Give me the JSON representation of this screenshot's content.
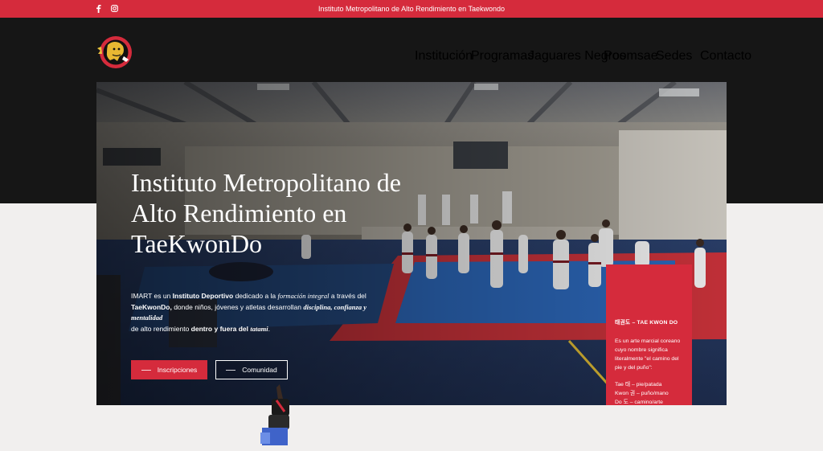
{
  "topbar": {
    "text": "Instituto Metropolitano de Alto Rendimiento en Taekwondo",
    "social": [
      "facebook-icon",
      "instagram-icon"
    ]
  },
  "nav": {
    "items": [
      "Institución",
      "Programas",
      "Jaguares Negros",
      "Poomsae",
      "Sedes",
      "Contacto"
    ]
  },
  "hero": {
    "title_line1": "Instituto Metropolitano de",
    "title_line2": "Alto Rendimiento en",
    "title_line3": "TaeKwonDo",
    "desc": {
      "p1": "IMART es un ",
      "p2": "Instituto Deportivo",
      "p3": " dedicado a la ",
      "p4": "formación integral",
      "p5": " a través del",
      "p6": "TaeKwonDo,",
      "p7": " donde niños, jóvenes y atletas desarrollan ",
      "p8": "disciplina, confianza y mentalidad",
      "p9": "de alto rendimiento ",
      "p10": "dentro y fuera del",
      "p11": " ",
      "p12": "tatami",
      "p13": "."
    },
    "button_primary": "Inscripciones",
    "button_secondary": "Comunidad"
  },
  "card": {
    "title": "태권도 – TAE KWON DO",
    "para1": "Es un arte marcial coreano cuyo nombre significa literalmente \"el camino del pie y del puño\":",
    "line1": "Tae 태 – pie/patada",
    "line2": "Kwon 권 – puño/mano",
    "line3": "Do 도 – camino/arte"
  },
  "colors": {
    "accent": "#d52b3c",
    "dark": "#161616",
    "light": "#f1efee",
    "mat_red": "#c9323a",
    "mat_blue": "#2c67b9"
  }
}
